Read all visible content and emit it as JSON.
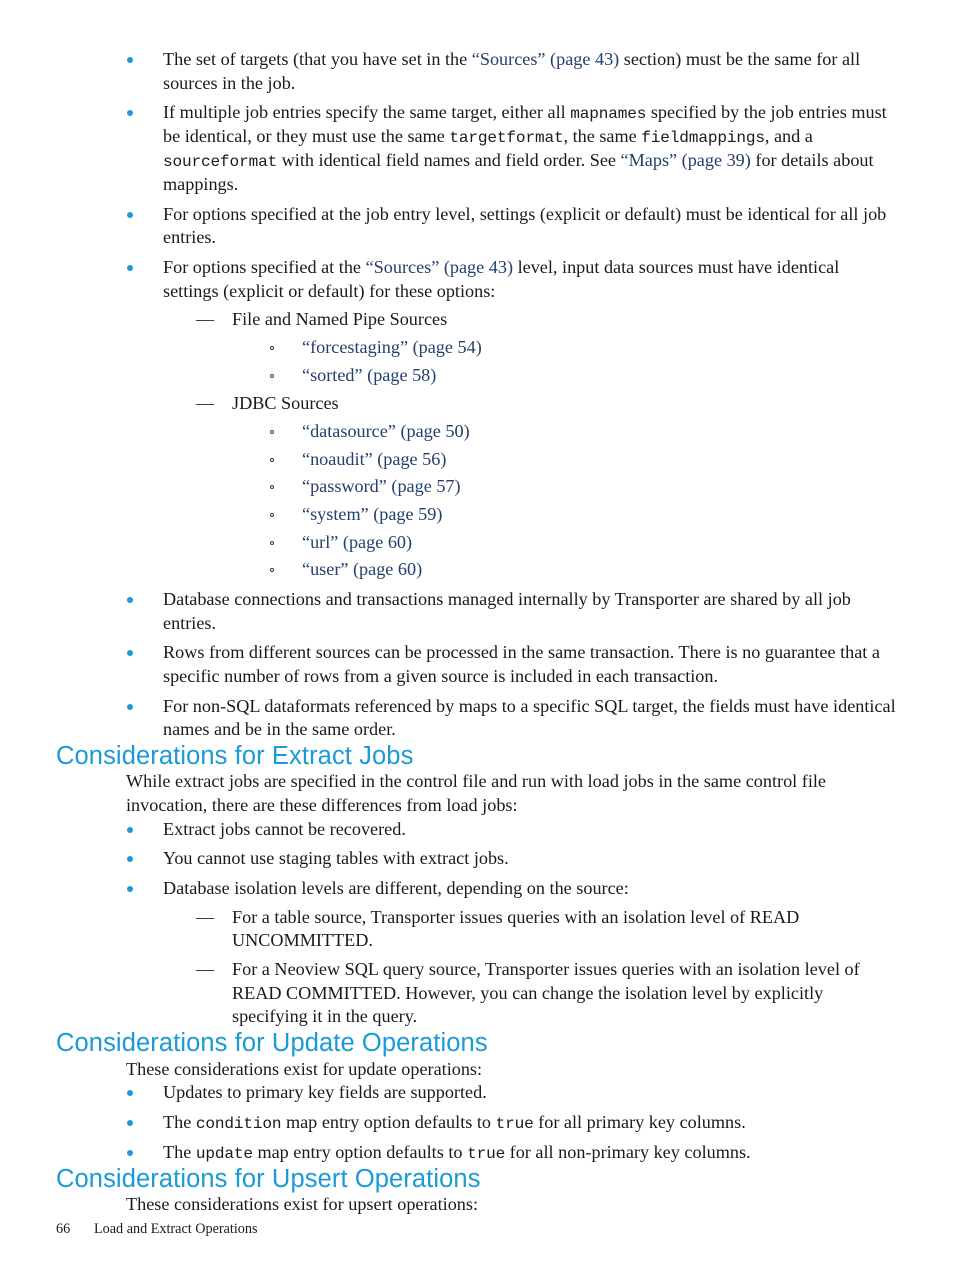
{
  "document": {
    "footer": {
      "page_number": "66",
      "running_title": "Load and Extract Operations"
    },
    "colors": {
      "heading": "#1A9AD7",
      "bullet": "#1A9AD7",
      "cross_reference": "#23406C",
      "body_text": "#1A1A1A",
      "page_background": "#FFFFFF"
    }
  },
  "top_list": {
    "items": [
      {
        "id": "targets-same",
        "segments": [
          {
            "type": "text",
            "value": "The set of targets (that you have set in the "
          },
          {
            "type": "xref",
            "value": "“Sources” (page 43)"
          },
          {
            "type": "text",
            "value": " section) must be the same for all sources in the job."
          }
        ],
        "plain": "The set of targets (that you have set in the “Sources” (page 43) section) must be the same for all sources in the job."
      },
      {
        "id": "multiple-job-entries",
        "segments": [
          {
            "type": "text",
            "value": "If multiple job entries specify the same target, either all "
          },
          {
            "type": "code",
            "value": "mapnames"
          },
          {
            "type": "text",
            "value": " specified by the job entries must be identical, or they must use the same "
          },
          {
            "type": "code",
            "value": "targetformat"
          },
          {
            "type": "text",
            "value": ", the same "
          },
          {
            "type": "code",
            "value": "fieldmappings"
          },
          {
            "type": "text",
            "value": ", and a "
          },
          {
            "type": "code",
            "value": "sourceformat"
          },
          {
            "type": "text",
            "value": " with identical field names and field order. See "
          },
          {
            "type": "xref",
            "value": "“Maps” (page 39)"
          },
          {
            "type": "text",
            "value": " for details about mappings."
          }
        ],
        "plain": "If multiple job entries specify the same target, either all mapnames specified by the job entries must be identical, or they must use the same targetformat, the same fieldmappings, and a sourceformat with identical field names and field order. See “Maps” (page 39) for details about mappings."
      },
      {
        "id": "job-entry-level-options",
        "segments": [
          {
            "type": "text",
            "value": "For options specified at the job entry level, settings (explicit or default) must be identical for all job entries."
          }
        ],
        "plain": "For options specified at the job entry level, settings (explicit or default) must be identical for all job entries."
      },
      {
        "id": "sources-level-options",
        "segments": [
          {
            "type": "text",
            "value": "For options specified at the "
          },
          {
            "type": "xref",
            "value": "“Sources” (page 43)"
          },
          {
            "type": "text",
            "value": " level, input data sources must have identical settings (explicit or default) for these options:"
          }
        ],
        "plain": "For options specified at the “Sources” (page 43) level, input data sources must have identical settings (explicit or default) for these options:",
        "sublist": [
          {
            "label": "File and Named Pipe Sources",
            "options": [
              "“forcestaging” (page 54)",
              "“sorted” (page 58)"
            ]
          },
          {
            "label": "JDBC Sources",
            "options": [
              "“datasource” (page 50)",
              "“noaudit” (page 56)",
              "“password” (page 57)",
              "“system” (page 59)",
              "“url” (page 60)",
              "“user” (page 60)"
            ]
          }
        ]
      },
      {
        "id": "db-connections-shared",
        "segments": [
          {
            "type": "text",
            "value": "Database connections and transactions managed internally by Transporter are shared by all job entries."
          }
        ],
        "plain": "Database connections and transactions managed internally by Transporter are shared by all job entries."
      },
      {
        "id": "rows-same-transaction",
        "segments": [
          {
            "type": "text",
            "value": "Rows from different sources can be processed in the same transaction. There is no guarantee that a specific number of rows from a given source is included in each transaction."
          }
        ],
        "plain": "Rows from different sources can be processed in the same transaction. There is no guarantee that a specific number of rows from a given source is included in each transaction."
      },
      {
        "id": "non-sql-dataformats",
        "segments": [
          {
            "type": "text",
            "value": "For non-SQL dataformats referenced by maps to a specific SQL target, the fields must have identical names and be in the same order."
          }
        ],
        "plain": "For non-SQL dataformats referenced by maps to a specific SQL target, the fields must have identical names and be in the same order."
      }
    ]
  },
  "extract_jobs": {
    "heading": "Considerations for Extract Jobs",
    "intro": "While extract jobs are specified in the control file and run with load jobs in the same control file invocation, there are these differences from load jobs:",
    "items": [
      {
        "plain": "Extract jobs cannot be recovered."
      },
      {
        "plain": "You cannot use staging tables with extract jobs."
      },
      {
        "plain": "Database isolation levels are different, depending on the source:",
        "sublist": [
          "For a table source, Transporter issues queries with an isolation level of READ UNCOMMITTED.",
          "For a Neoview SQL query source, Transporter issues queries with an isolation level of READ COMMITTED. However, you can change the isolation level by explicitly specifying it in the query."
        ]
      }
    ]
  },
  "update_operations": {
    "heading": "Considerations for Update Operations",
    "intro": "These considerations exist for update operations:",
    "items": [
      {
        "segments": [
          {
            "type": "text",
            "value": "Updates to primary key fields are supported."
          }
        ],
        "plain": "Updates to primary key fields are supported."
      },
      {
        "segments": [
          {
            "type": "text",
            "value": "The "
          },
          {
            "type": "code",
            "value": "condition"
          },
          {
            "type": "text",
            "value": " map entry option defaults to "
          },
          {
            "type": "code",
            "value": "true"
          },
          {
            "type": "text",
            "value": " for all primary key columns."
          }
        ],
        "plain": "The condition map entry option defaults to true for all primary key columns."
      },
      {
        "segments": [
          {
            "type": "text",
            "value": "The "
          },
          {
            "type": "code",
            "value": "update"
          },
          {
            "type": "text",
            "value": " map entry option defaults to "
          },
          {
            "type": "code",
            "value": "true"
          },
          {
            "type": "text",
            "value": " for all non-primary key columns."
          }
        ],
        "plain": "The update map entry option defaults to true for all non-primary key columns."
      }
    ]
  },
  "upsert_operations": {
    "heading": "Considerations for Upsert Operations",
    "intro": "These considerations exist for upsert operations:"
  }
}
